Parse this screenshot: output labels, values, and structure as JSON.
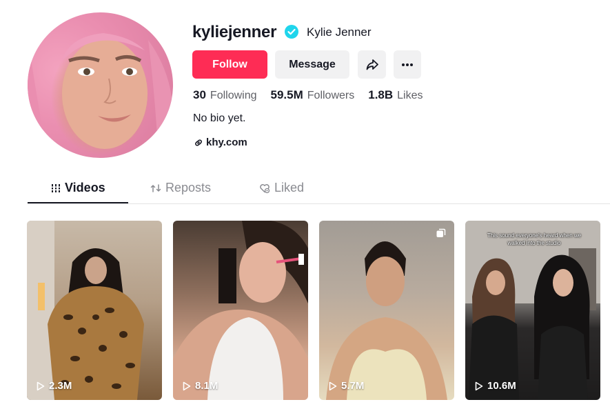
{
  "profile": {
    "username": "kyliejenner",
    "nickname": "Kylie Jenner",
    "verified": true,
    "verified_icon": "verified-badge-icon",
    "bio": "No bio yet.",
    "link": "khy.com",
    "link_icon": "link-icon"
  },
  "actions": {
    "follow_label": "Follow",
    "message_label": "Message",
    "share_icon": "share-icon",
    "more_icon": "more-dots-icon"
  },
  "stats": {
    "following_count": "30",
    "following_label": "Following",
    "followers_count": "59.5M",
    "followers_label": "Followers",
    "likes_count": "1.8B",
    "likes_label": "Likes"
  },
  "tabs": {
    "videos": "Videos",
    "reposts": "Reposts",
    "liked": "Liked",
    "active": "videos"
  },
  "videos": [
    {
      "views": "2.3M",
      "multi": false
    },
    {
      "views": "8.1M",
      "multi": false
    },
    {
      "views": "5.7M",
      "multi": true
    },
    {
      "views": "10.6M",
      "multi": false,
      "caption": "This sound everyone's heard when we walked into the studio"
    }
  ],
  "colors": {
    "accent": "#fe2c55",
    "verified": "#20d5ec",
    "text": "#161823",
    "muted": "#5e5f65",
    "button_bg": "#f1f1f2"
  }
}
